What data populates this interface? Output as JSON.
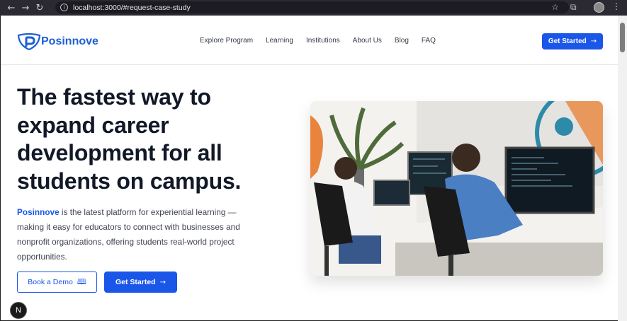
{
  "browser": {
    "back_icon": "arrow-left-icon",
    "forward_icon": "arrow-right-icon",
    "reload_icon": "reload-icon",
    "url": "localhost:3000/#request-case-study"
  },
  "header": {
    "brand": "Posinnove",
    "nav": [
      "Explore Program",
      "Learning",
      "Institutions",
      "About Us",
      "Blog",
      "FAQ"
    ],
    "cta_label": "Get Started"
  },
  "hero": {
    "title": "The fastest way to expand career development for all students on campus.",
    "desc_brand": "Posinnove",
    "desc_rest": " is the latest platform for experiential learning — making it easy for educators to connect with businesses and nonprofit organizations, offering students real-world project opportunities.",
    "demo_label": "Book a Demo",
    "start_label": "Get Started"
  },
  "badge": "N",
  "colors": {
    "accent": "#1a56e8",
    "text_dark": "#111827",
    "chrome_bg": "#2b2a33"
  }
}
